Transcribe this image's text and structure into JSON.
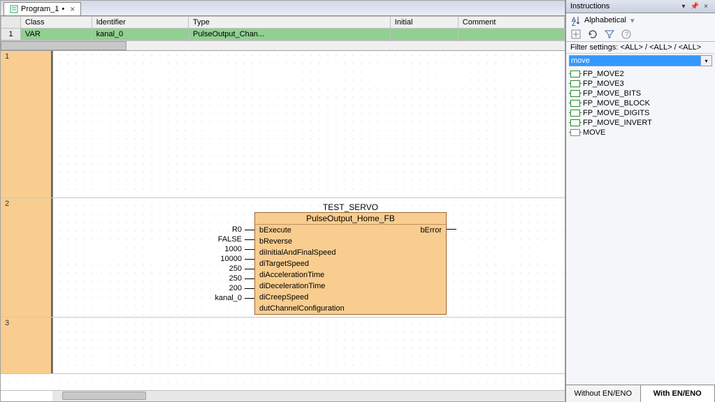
{
  "tab": {
    "label": "Program_1",
    "dirty": "•",
    "close": "×"
  },
  "var_table": {
    "headers": {
      "class": "Class",
      "identifier": "Identifier",
      "type": "Type",
      "initial": "Initial",
      "comment": "Comment"
    },
    "row_num": "1",
    "row": {
      "class": "VAR",
      "identifier": "kanal_0",
      "type": "PulseOutput_Chan...",
      "initial": "",
      "comment": ""
    }
  },
  "networks": {
    "n1": "1",
    "n2": "2",
    "n3": "3"
  },
  "fb": {
    "instance": "TEST_SERVO",
    "type": "PulseOutput_Home_FB",
    "inputs": [
      {
        "val": "R0",
        "name": "bExecute"
      },
      {
        "val": "FALSE",
        "name": "bReverse"
      },
      {
        "val": "1000",
        "name": "diInitialAndFinalSpeed"
      },
      {
        "val": "10000",
        "name": "diTargetSpeed"
      },
      {
        "val": "250",
        "name": "diAccelerationTime"
      },
      {
        "val": "250",
        "name": "diDecelerationTime"
      },
      {
        "val": "200",
        "name": "diCreepSpeed"
      },
      {
        "val": "kanal_0",
        "name": "dutChannelConfiguration"
      }
    ],
    "outputs": [
      {
        "name": "bError"
      }
    ]
  },
  "panel": {
    "title": "Instructions",
    "sort_label": "Alphabetical",
    "filter_label": "Filter settings: <ALL> / <ALL> / <ALL>",
    "search_value": "move",
    "items": [
      "FP_MOVE2",
      "FP_MOVE3",
      "FP_MOVE_BITS",
      "FP_MOVE_BLOCK",
      "FP_MOVE_DIGITS",
      "FP_MOVE_INVERT",
      "MOVE"
    ],
    "footer": {
      "without": "Without EN/ENO",
      "with": "With EN/ENO"
    }
  }
}
